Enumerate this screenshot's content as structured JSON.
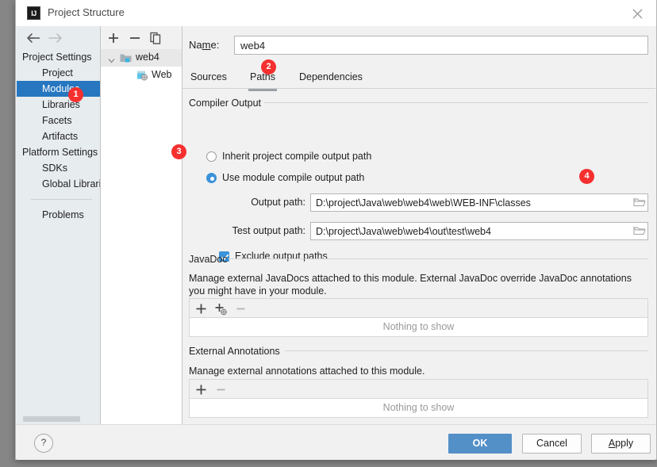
{
  "window": {
    "title": "Project Structure",
    "logo_text": "IJ",
    "close_icon": "close-icon"
  },
  "nav": {
    "back_icon": "arrow-left-icon",
    "forward_icon": "arrow-right-icon",
    "groups": [
      {
        "label": "Project Settings",
        "items": [
          {
            "label": "Project",
            "selected": false
          },
          {
            "label": "Modules",
            "selected": true
          },
          {
            "label": "Libraries",
            "selected": false
          },
          {
            "label": "Facets",
            "selected": false
          },
          {
            "label": "Artifacts",
            "selected": false
          }
        ]
      },
      {
        "label": "Platform Settings",
        "items": [
          {
            "label": "SDKs",
            "selected": false
          },
          {
            "label": "Global Libraries",
            "selected": false
          }
        ]
      }
    ],
    "extra": [
      {
        "label": "Problems",
        "selected": false
      }
    ],
    "selected_color": "#2776c0"
  },
  "tree": {
    "toolbar": {
      "add_icon": "plus-icon",
      "remove_icon": "minus-icon",
      "copy_icon": "copy-icon"
    },
    "rows": [
      {
        "label": "web4",
        "icon": "module-folder-icon",
        "depth": 0,
        "expanded": true,
        "selected": true
      },
      {
        "label": "Web",
        "icon": "web-facet-icon",
        "depth": 1,
        "expanded": null,
        "selected": false
      }
    ]
  },
  "main": {
    "name_label_pre": "Na",
    "name_label_mnemonic": "m",
    "name_label_post": "e:",
    "name_value": "web4",
    "name_placeholder": "",
    "tabs": [
      {
        "label": "Sources",
        "active": false
      },
      {
        "label": "Paths",
        "active": true
      },
      {
        "label": "Dependencies",
        "active": false
      }
    ],
    "compiler_output": {
      "title": "Compiler Output",
      "radios": [
        {
          "label": "Inherit project compile output path",
          "checked": false
        },
        {
          "label": "Use module compile output path",
          "checked": true
        }
      ],
      "output_path_label": "Output path:",
      "output_path_value": "D:\\project\\Java\\web\\web4\\web\\WEB-INF\\classes",
      "test_output_path_label": "Test output path:",
      "test_output_path_value": "D:\\project\\Java\\web\\web4\\out\\test\\web4",
      "browse_icon": "folder-browse-icon",
      "exclude_label": "Exclude output paths",
      "exclude_checked": true
    },
    "javadoc": {
      "title": "JavaDoc",
      "description": "Manage external JavaDocs attached to this module. External JavaDoc override JavaDoc annotations you might have in your module.",
      "toolbar": {
        "add_icon": "plus-icon",
        "add_url_icon": "plus-globe-icon",
        "remove_icon": "minus-icon"
      },
      "empty_text": "Nothing to show"
    },
    "external_annotations": {
      "title": "External Annotations",
      "description": "Manage external annotations attached to this module.",
      "toolbar": {
        "add_icon": "plus-icon",
        "remove_icon": "minus-icon"
      },
      "empty_text": "Nothing to show"
    }
  },
  "footer": {
    "help_label": "?",
    "ok_label": "OK",
    "cancel_label": "Cancel",
    "apply_label_pre": "",
    "apply_mnemonic": "A",
    "apply_label_post": "pply"
  },
  "badges": [
    {
      "num": "1"
    },
    {
      "num": "2"
    },
    {
      "num": "3"
    },
    {
      "num": "4"
    }
  ],
  "colors": {
    "accent_blue": "#2776c0",
    "primary_button": "#5490c8",
    "badge_red": "#f62f2f",
    "control_blue": "#3b93d9"
  }
}
